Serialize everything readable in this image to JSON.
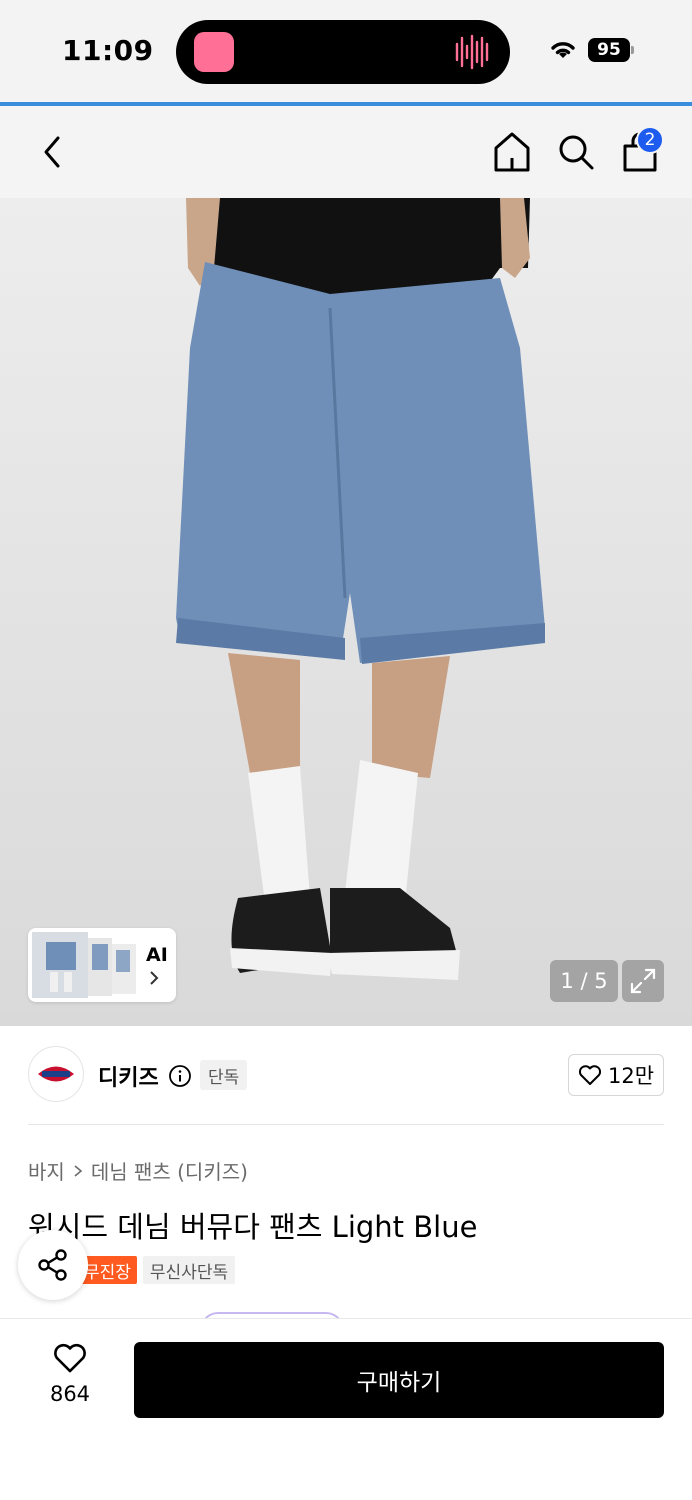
{
  "status_bar": {
    "time": "11:09",
    "battery": "95"
  },
  "nav": {
    "cart_count": "2"
  },
  "gallery": {
    "ai_label": "AI",
    "page_counter": "1 / 5"
  },
  "brand": {
    "name": "디키즈",
    "badge": "단독",
    "likes": "12만"
  },
  "breadcrumb": {
    "category": "바지",
    "subcategory": "데님 팬츠 (디키즈)"
  },
  "product": {
    "title": "워시드 데님 버뮤다 팬츠 Light Blue",
    "tags": [
      "무진장",
      "무신사단독"
    ]
  },
  "bottom": {
    "wish_count": "864",
    "buy_label": "구매하기"
  },
  "colors": {
    "accent_blue": "#1e5cf0",
    "tag_orange": "#ff5a1f",
    "buy_black": "#000000"
  }
}
